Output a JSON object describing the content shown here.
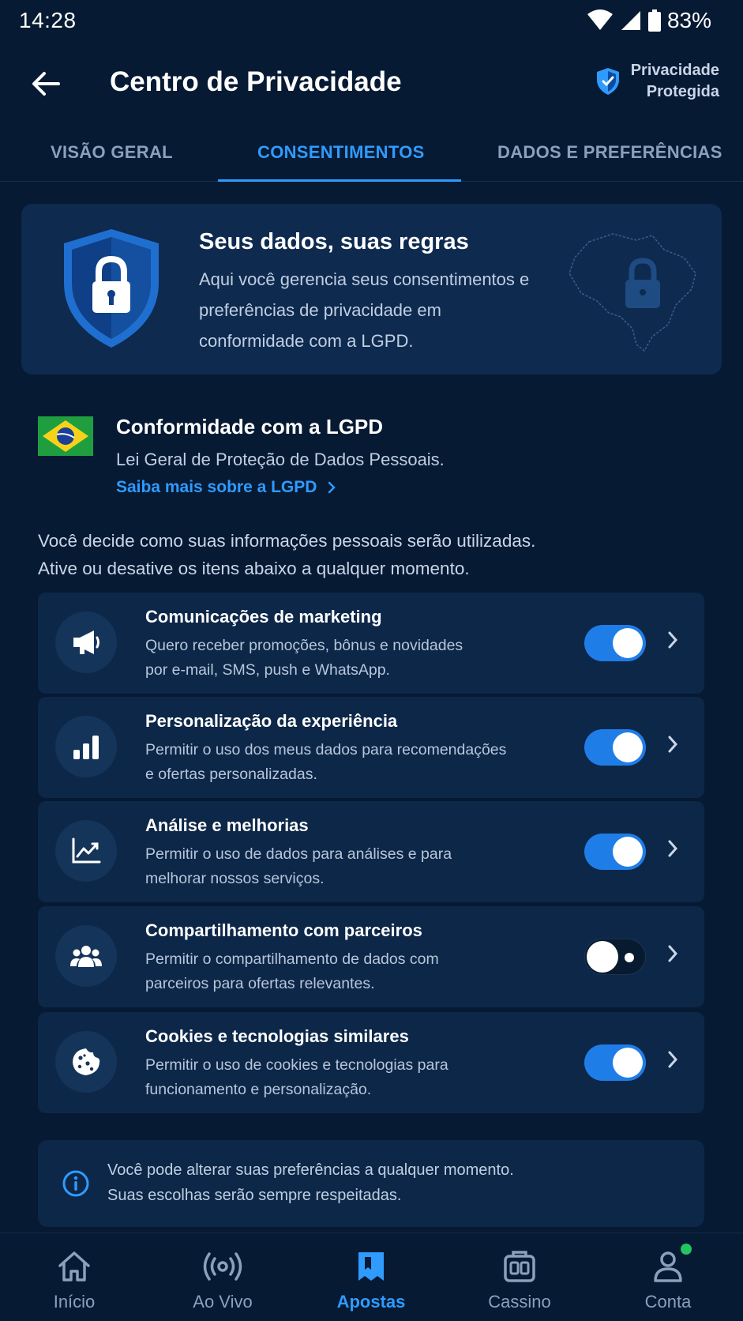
{
  "status_bar": {
    "time": "14:28",
    "battery": "83%"
  },
  "header": {
    "title": "Centro de Privacidade",
    "badge_line1": "Privacidade",
    "badge_line2": "Protegida"
  },
  "tabs": [
    {
      "label": "VISÃO GERAL",
      "active": false
    },
    {
      "label": "CONSENTIMENTOS",
      "active": true
    },
    {
      "label": "DADOS E PREFERÊNCIAS",
      "active": false
    }
  ],
  "hero": {
    "title": "Seus dados, suas regras",
    "description": "Aqui você gerencia seus consentimentos e preferências de privacidade em conformidade com a LGPD."
  },
  "lgpd": {
    "title": "Conformidade com a LGPD",
    "subtitle": "Lei Geral de Proteção de Dados Pessoais.",
    "link": "Saiba mais sobre a LGPD"
  },
  "intro": {
    "line1": "Você decide como suas informações pessoais serão utilizadas.",
    "line2": "Ative ou desative os itens abaixo a qualquer momento."
  },
  "consents": [
    {
      "icon": "megaphone-icon",
      "title": "Comunicações de marketing",
      "line1": "Quero receber promoções, bônus e novidades",
      "line2": "por e-mail, SMS, push e WhatsApp.",
      "enabled": true
    },
    {
      "icon": "bar-chart-icon",
      "title": "Personalização da experiência",
      "line1": "Permitir o uso dos meus dados para recomendações",
      "line2": "e ofertas personalizadas.",
      "enabled": true
    },
    {
      "icon": "trend-chart-icon",
      "title": "Análise e melhorias",
      "line1": "Permitir o uso de dados para análises e para",
      "line2": "melhorar nossos serviços.",
      "enabled": true
    },
    {
      "icon": "users-icon",
      "title": "Compartilhamento com parceiros",
      "line1": "Permitir o compartilhamento de dados com",
      "line2": "parceiros para ofertas relevantes.",
      "enabled": false
    },
    {
      "icon": "cookie-icon",
      "title": "Cookies e tecnologias similares",
      "line1": "Permitir o uso de cookies e tecnologias para",
      "line2": "funcionamento e personalização.",
      "enabled": true
    }
  ],
  "info_note": {
    "line1": "Você pode alterar suas preferências a qualquer momento.",
    "line2": "Suas escolhas serão sempre respeitadas."
  },
  "bottom_nav": [
    {
      "label": "Início",
      "icon": "home-icon",
      "active": false
    },
    {
      "label": "Ao Vivo",
      "icon": "live-icon",
      "active": false
    },
    {
      "label": "Apostas",
      "icon": "bets-icon",
      "active": true
    },
    {
      "label": "Cassino",
      "icon": "casino-icon",
      "active": false
    },
    {
      "label": "Conta",
      "icon": "account-icon",
      "active": false
    }
  ],
  "colors": {
    "background": "#071a33",
    "card": "#0d2748",
    "accent": "#2f9bff",
    "toggle_on": "#1f7de8",
    "notification": "#22c55e"
  }
}
